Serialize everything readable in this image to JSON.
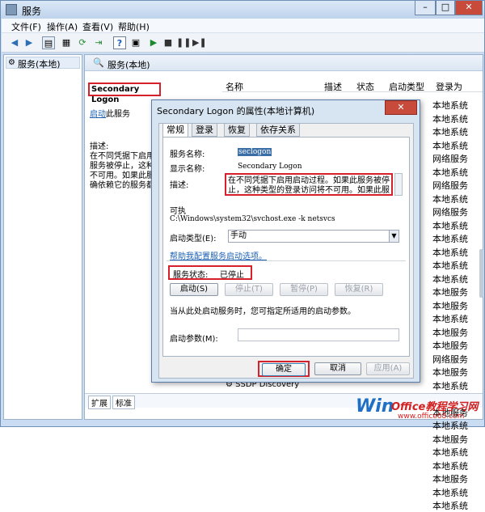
{
  "window": {
    "title": "服务"
  },
  "window_controls": {
    "minimize": "–",
    "maximize": "□",
    "close": "✕"
  },
  "menu": [
    "文件(F)",
    "操作(A)",
    "查看(V)",
    "帮助(H)"
  ],
  "toolbar": {
    "icons": [
      "back-icon",
      "forward-icon",
      "show-tree-icon",
      "properties-icon",
      "refresh-icon",
      "export-icon",
      "help-icon",
      "console-icon",
      "start-icon",
      "stop-icon",
      "pause-icon",
      "restart-icon"
    ]
  },
  "tree": {
    "root_label": "服务(本地)"
  },
  "pane": {
    "header": "服务(本地)",
    "service_name": "Secondary Logon",
    "start_link": "启动",
    "start_suffix": "此服务",
    "desc_label": "描述:",
    "desc_lines": [
      "在不同凭据下启用",
      "服务被停止，这种",
      "不可用。如果此服",
      "确依赖它的服务都"
    ]
  },
  "grid": {
    "columns": [
      "名称",
      "描述",
      "状态",
      "启动类型",
      "登录为"
    ],
    "visible_name": "SSDP Discovery",
    "logon_as": [
      "本地系统",
      "本地系统",
      "本地系统",
      "本地系统",
      "网络服务",
      "本地系统",
      "网络服务",
      "本地系统",
      "网络服务",
      "本地系统",
      "本地系统",
      "本地系统",
      "本地系统",
      "本地系统",
      "本地服务",
      "本地服务",
      "本地系统",
      "本地服务",
      "本地服务",
      "网络服务",
      "本地服务",
      "本地系统",
      "本地系统",
      "本地服务",
      "本地系统",
      "本地服务",
      "本地系统",
      "本地系统",
      "本地服务",
      "本地系统",
      "本地系统"
    ]
  },
  "bottom_tabs": [
    "扩展",
    "标准"
  ],
  "dialog": {
    "title": "Secondary Logon 的属性(本地计算机)",
    "close": "✕",
    "tabs": [
      "常规",
      "登录",
      "恢复",
      "依存关系"
    ],
    "service_name_label": "服务名称:",
    "service_name": "seclogon",
    "display_name_label": "显示名称:",
    "display_name": "Secondary Logon",
    "description_label": "描述:",
    "description": "在不同凭据下启用启动过程。如果此服务被停止，这种类型的登录访问将不可用。如果此服",
    "exec_label": "可执",
    "exec_path": "C:\\Windows\\system32\\svchost.exe -k netsvcs",
    "startup_label": "启动类型(E):",
    "startup_value": "手动",
    "help_link": "帮助我配置服务启动选项。",
    "status_label": "服务状态:",
    "status_value": "已停止",
    "buttons": {
      "start": "启动(S)",
      "stop": "停止(T)",
      "pause": "暂停(P)",
      "resume": "恢复(R)"
    },
    "hint": "当从此处启动服务时，您可指定所适用的启动参数。",
    "params_label": "启动参数(M):",
    "ok": "确定",
    "cancel": "取消",
    "apply": "应用(A)"
  },
  "watermark": {
    "brand": "Win",
    "site_cn": "Office教程学习网",
    "site_url": "www.office68.com"
  },
  "colors": {
    "highlight": "#d6202c",
    "link": "#1a5fb4",
    "title_bg": "#c9dcf2"
  }
}
